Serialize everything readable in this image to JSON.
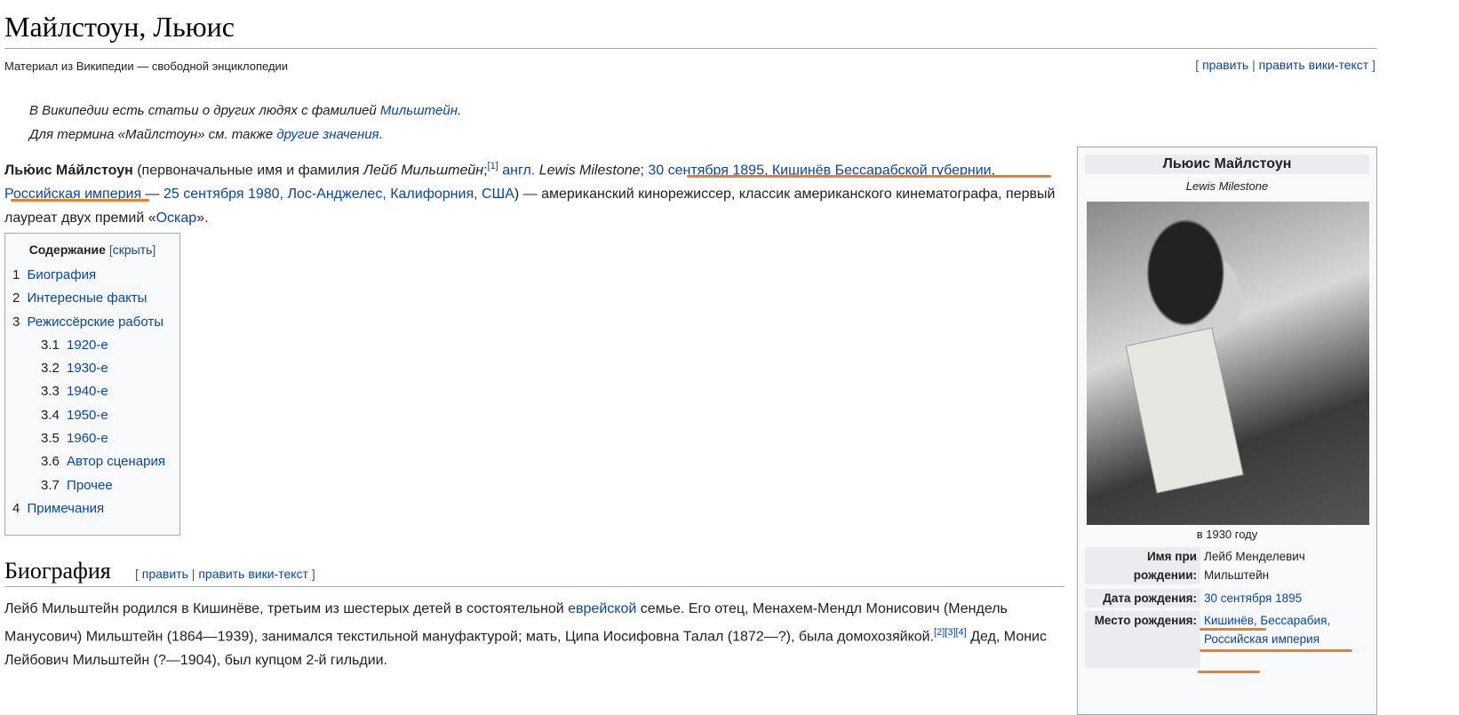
{
  "title": "Майлстоун, Льюис",
  "subtitle": "Материал из Википедии — свободной энциклопедии",
  "edit": {
    "edit": "править",
    "edit_source": "править вики-текст"
  },
  "hatnote": {
    "l1_pre": "В Википедии есть статьи о других людях с фамилией ",
    "l1_link": "Мильштейн",
    "l1_post": ".",
    "l2_pre": "Для термина «Майлстоун» см. также ",
    "l2_link": "другие значения",
    "l2_post": "."
  },
  "intro": {
    "name": "Лью́ис Ма́йлстоун",
    "t1": " (первоначальные имя и фамилия ",
    "orig": "Лейб Мильштейн",
    "t2": ";",
    "ref1": "[1]",
    "eng": "англ.",
    "eng_name": "Lewis Milestone",
    "t3": "; ",
    "birth": "30 сентября 1895, Кишинёв Бессарабской губернии",
    "t4": ", ",
    "empire": "Российская империя",
    "t5": " — ",
    "death": "25 сентября 1980, Лос-Анджелес, Калифорния, США",
    "t6": ") — американский кинорежиссер, классик американского кинематографа, первый лауреат двух премий «",
    "oscar": "Оскар",
    "t7": "»."
  },
  "toc": {
    "title": "Содержание",
    "hide": "скрыть",
    "items": [
      {
        "n": "1",
        "t": "Биография"
      },
      {
        "n": "2",
        "t": "Интересные факты"
      },
      {
        "n": "3",
        "t": "Режиссёрские работы"
      },
      {
        "n": "3.1",
        "t": "1920-е"
      },
      {
        "n": "3.2",
        "t": "1930-е"
      },
      {
        "n": "3.3",
        "t": "1940-е"
      },
      {
        "n": "3.4",
        "t": "1950-е"
      },
      {
        "n": "3.5",
        "t": "1960-е"
      },
      {
        "n": "3.6",
        "t": "Автор сценария"
      },
      {
        "n": "3.7",
        "t": "Прочее"
      },
      {
        "n": "4",
        "t": "Примечания"
      }
    ]
  },
  "infobox": {
    "name": "Льюис Майлстоун",
    "orig": "Lewis Milestone",
    "caption": "в 1930 году",
    "rows": [
      {
        "k": "Имя при рождении:",
        "v": "Лейб Менделевич Мильштейн"
      },
      {
        "k": "Дата рождения:",
        "v": "30 сентября 1895"
      },
      {
        "k": "Место рождения:",
        "v": "Кишинёв, Бессарабия, Российская империя"
      }
    ]
  },
  "bio": {
    "heading": "Биография",
    "p1": "Лейб Мильштейн родился в Кишинёве, третьим из шестерых детей в состоятельной ",
    "link": "еврейской",
    "p2": " семье. Его отец, Менахем-Мендл Монисович (Мендель Манусович) Мильштейн (1864—1939), занимался текстильной мануфактурой; мать, Ципа Иосифовна Талал (1872—?), была домохозяйкой.",
    "refs": "[2][3][4]",
    "p3": " Дед, Монис Лейбович Мильштейн (?—1904), был купцом 2-й гильдии."
  }
}
